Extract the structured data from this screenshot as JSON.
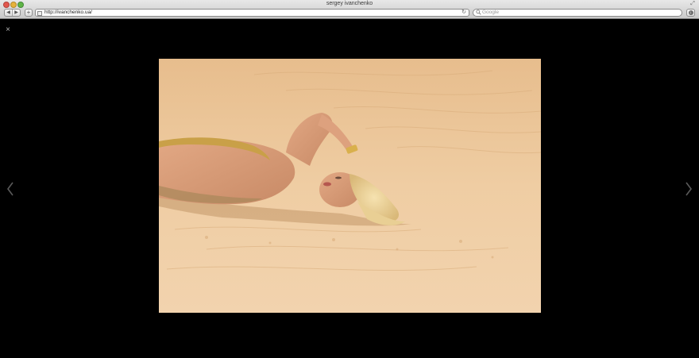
{
  "window": {
    "title": "sergey ivanchenko"
  },
  "toolbar": {
    "back_icon": "◀",
    "forward_icon": "▶",
    "add_icon": "+",
    "url": "http://ivanchenko.ua/",
    "reload_icon": "↻",
    "search_icon": "🔍",
    "search_placeholder": "Google",
    "downloads_icon": "↓",
    "fullscreen_icon": "⤢"
  },
  "lightbox": {
    "close_glyph": "×",
    "photo_subject": "photo-woman-lying-on-sand",
    "prev_icon": "chevron-left-icon",
    "next_icon": "chevron-right-icon"
  },
  "colors": {
    "background": "#000000",
    "sand": "#e9c394",
    "arrow": "#5a5a5a"
  }
}
